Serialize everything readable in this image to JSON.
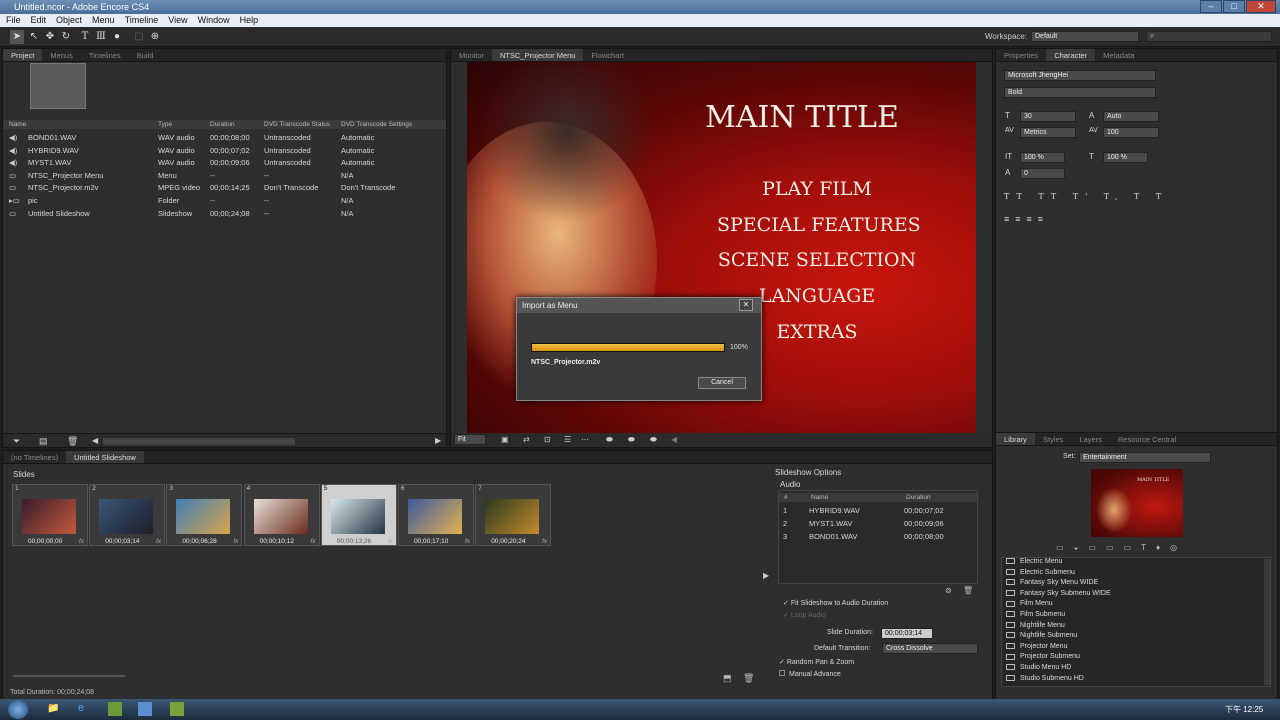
{
  "window": {
    "title": "Untitled.ncor - Adobe Encore CS4"
  },
  "menu": [
    "File",
    "Edit",
    "Object",
    "Menu",
    "Timeline",
    "View",
    "Window",
    "Help"
  ],
  "workspace": {
    "label": "Workspace:",
    "value": "Default"
  },
  "project": {
    "tabs": [
      "Project",
      "Menus",
      "Timelines",
      "Build"
    ],
    "columns": [
      "Name",
      "Type",
      "Duration",
      "DVD Transcode Status",
      "DVD Transcode Settings"
    ],
    "rows": [
      {
        "name": "BOND01.WAV",
        "type": "WAV audio",
        "duration": "00;00;08;00",
        "status": "Untranscoded",
        "settings": "Automatic",
        "icon": "audio-icon"
      },
      {
        "name": "HYBRID9.WAV",
        "type": "WAV audio",
        "duration": "00;00;07;02",
        "status": "Untranscoded",
        "settings": "Automatic",
        "icon": "audio-icon"
      },
      {
        "name": "MYST1.WAV",
        "type": "WAV audio",
        "duration": "00;00;09;06",
        "status": "Untranscoded",
        "settings": "Automatic",
        "icon": "audio-icon"
      },
      {
        "name": "NTSC_Projector Menu",
        "type": "Menu",
        "duration": "--",
        "status": "--",
        "settings": "N/A",
        "icon": "menu-icon"
      },
      {
        "name": "NTSC_Projector.m2v",
        "type": "MPEG video",
        "duration": "00;00;14;25",
        "status": "Don't Transcode",
        "settings": "Don't Transcode",
        "icon": "video-icon"
      },
      {
        "name": "pic",
        "type": "Folder",
        "duration": "--",
        "status": "--",
        "settings": "N/A",
        "icon": "folder-icon"
      },
      {
        "name": "Untitled Slideshow",
        "type": "Slideshow",
        "duration": "00;00;24;08",
        "status": "--",
        "settings": "N/A",
        "icon": "slideshow-icon"
      }
    ]
  },
  "monitor": {
    "tabs": [
      "Monitor",
      "NTSC_Projector Menu",
      "Flowchart"
    ],
    "fit_label": "Fit",
    "menu_title": "MAIN TITLE",
    "menu_items": [
      "PLAY FILM",
      "SPECIAL FEATURES",
      "SCENE SELECTION",
      "LANGUAGE",
      "EXTRAS"
    ]
  },
  "dialog": {
    "title": "Import as Menu",
    "progress_label": "100%",
    "progress": 1.0,
    "file": "NTSC_Projector.m2v",
    "cancel": "Cancel"
  },
  "character": {
    "tabs": [
      "Properties",
      "Character",
      "Metadata"
    ],
    "font": "Microsoft JhengHei",
    "style": "Bold",
    "size": "30",
    "leading": "Auto",
    "kerning": "Metrics",
    "tracking": "100",
    "vscale": "100 %",
    "hscale": "100 %",
    "baseline": "0"
  },
  "slideshow": {
    "tabs": [
      "(no Timelines)",
      "Untitled Slideshow"
    ],
    "slides_label": "Slides",
    "slides": [
      {
        "num": "1",
        "duration": "00;00;00;00",
        "colors": [
          "#3a1c2c",
          "#c4593c"
        ]
      },
      {
        "num": "2",
        "duration": "00;00;03;14",
        "colors": [
          "#3a5776",
          "#1d1d2a"
        ]
      },
      {
        "num": "3",
        "duration": "00;00;06;28",
        "colors": [
          "#3f80b8",
          "#d9a34a"
        ]
      },
      {
        "num": "4",
        "duration": "00;00;10;12",
        "colors": [
          "#e8e0d8",
          "#6a2a1e"
        ]
      },
      {
        "num": "5",
        "duration": "00;00;13;26",
        "colors": [
          "#d8e8ee",
          "#263340"
        ]
      },
      {
        "num": "6",
        "duration": "00;00;17;10",
        "colors": [
          "#3c5a9e",
          "#e2b050"
        ]
      },
      {
        "num": "7",
        "duration": "00;00;20;24",
        "colors": [
          "#2a3a1e",
          "#c58a2c"
        ]
      }
    ],
    "total_duration": "Total Duration: 00;00;24;08"
  },
  "options": {
    "title": "Slideshow Options",
    "audio_label": "Audio",
    "columns": [
      "#",
      "Name",
      "Duration"
    ],
    "audio": [
      {
        "num": "1",
        "name": "HYBRID9.WAV",
        "duration": "00;00;07;02"
      },
      {
        "num": "2",
        "name": "MYST1.WAV",
        "duration": "00;00;09;06"
      },
      {
        "num": "3",
        "name": "BOND01.WAV",
        "duration": "00;00;08;00"
      }
    ],
    "fit_label": "Fit Slideshow to Audio Duration",
    "loop_label": "Loop Audio",
    "slide_duration_label": "Slide Duration:",
    "slide_duration": "00;00;03;14",
    "transition_label": "Default Transition:",
    "transition": "Cross Dissolve",
    "random_label": "Random Pan & Zoom",
    "manual_label": "Manual Advance"
  },
  "library": {
    "tabs": [
      "Library",
      "Styles",
      "Layers",
      "Resource Central"
    ],
    "set_label": "Set:",
    "set_value": "Entertainment",
    "preview_title": "MAIN TITLE",
    "items": [
      "Electric Menu",
      "Electric Submenu",
      "Fantasy Sky Menu WIDE",
      "Fantasy Sky Submenu WIDE",
      "Film Menu",
      "Film Submenu",
      "Nightlife Menu",
      "Nightlife Submenu",
      "Projector Menu",
      "Projector Submenu",
      "Studio Menu HD",
      "Studio Submenu HD"
    ]
  },
  "taskbar": {
    "time": "下午 12:25"
  }
}
